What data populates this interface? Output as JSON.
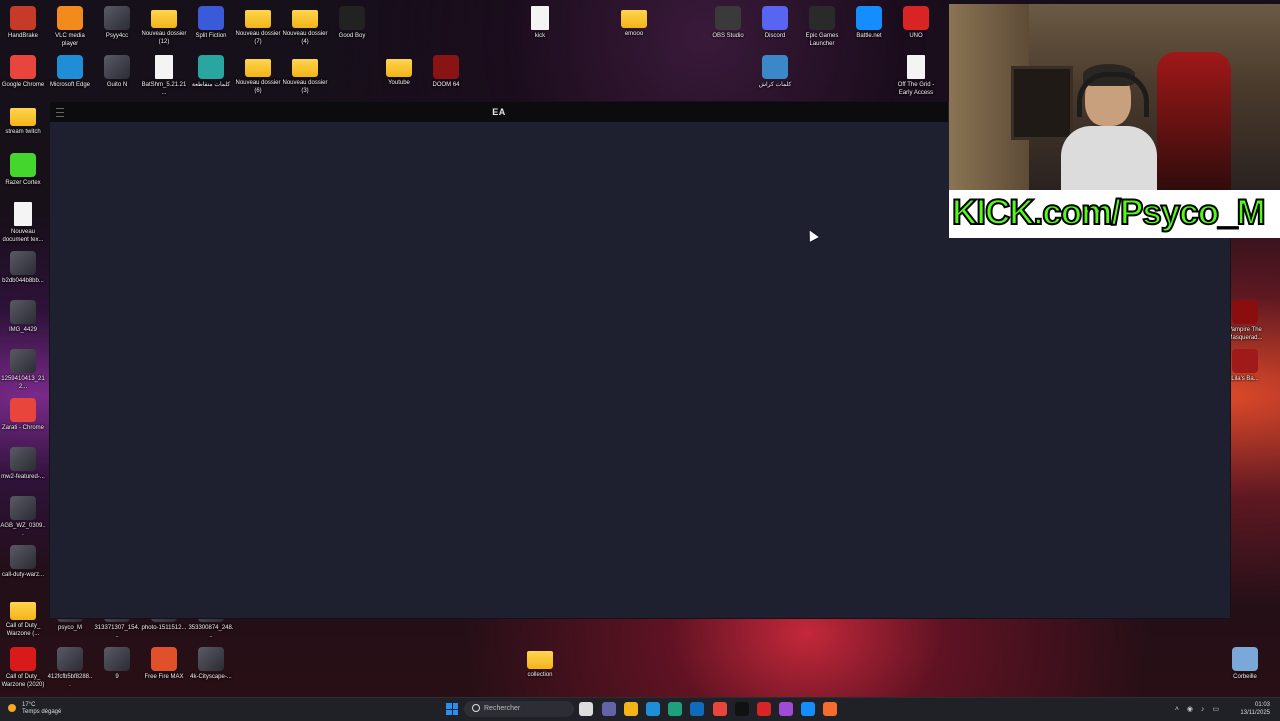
{
  "desktop": {
    "icons_top": [
      {
        "label": "HandBrake",
        "type": "app",
        "color": "#c63a2a"
      },
      {
        "label": "VLC media player",
        "type": "app",
        "color": "#f28a1c"
      },
      {
        "label": "Psyy4cc",
        "type": "photo",
        "color": ""
      },
      {
        "label": "Nouveau dossier (12)",
        "type": "folder",
        "color": ""
      },
      {
        "label": "Split Fiction",
        "type": "app",
        "color": "#3a5ad8"
      },
      {
        "label": "Nouveau dossier (7)",
        "type": "folder",
        "color": ""
      },
      {
        "label": "Nouveau dossier (4)",
        "type": "folder",
        "color": ""
      },
      {
        "label": "Good Boy",
        "type": "app",
        "color": "#222222"
      }
    ],
    "icons_top_row2": [
      {
        "label": "Google Chrome",
        "type": "app",
        "color": "#e8453c"
      },
      {
        "label": "Microsoft Edge",
        "type": "app",
        "color": "#1e8fd6"
      },
      {
        "label": "Guito N",
        "type": "photo",
        "color": ""
      },
      {
        "label": "BatShm_5.21.21...",
        "type": "doc",
        "color": ""
      },
      {
        "label": "كلمات متقاطعة",
        "type": "app",
        "color": "#2aa6a0"
      },
      {
        "label": "Nouveau dossier (6)",
        "type": "folder",
        "color": ""
      },
      {
        "label": "Nouveau dossier (3)",
        "type": "folder",
        "color": ""
      }
    ],
    "icons_mid": [
      {
        "label": "kick",
        "type": "doc",
        "color": ""
      },
      {
        "label": "emooo",
        "type": "folder",
        "color": ""
      },
      {
        "label": "Youtube",
        "type": "folder",
        "color": ""
      },
      {
        "label": "DOOM 64",
        "type": "app",
        "color": "#8a1414"
      },
      {
        "label": "OBS Studio",
        "type": "app",
        "color": "#3a3a3a"
      },
      {
        "label": "Discord",
        "type": "app",
        "color": "#5865f2"
      },
      {
        "label": "Epic Games Launcher",
        "type": "app",
        "color": "#2a2a2a"
      },
      {
        "label": "Battle.net",
        "type": "app",
        "color": "#148eff"
      },
      {
        "label": "UNO",
        "type": "app",
        "color": "#d82424"
      },
      {
        "label": "كلمات كراش",
        "type": "app",
        "color": "#3a88c8"
      },
      {
        "label": "Off The Grid - Early Access",
        "type": "doc",
        "color": ""
      }
    ],
    "icons_left": [
      {
        "label": "stream twitch",
        "type": "folder",
        "color": ""
      },
      {
        "label": "Razer Cortex",
        "type": "app",
        "color": "#44d62c"
      },
      {
        "label": "Nouveau document tex...",
        "type": "doc",
        "color": ""
      },
      {
        "label": "b2db044b8bb...",
        "type": "photo",
        "color": ""
      },
      {
        "label": "IMG_4429",
        "type": "photo",
        "color": ""
      },
      {
        "label": "1259410413_212...",
        "type": "photo",
        "color": ""
      },
      {
        "label": "Zarati - Chrome",
        "type": "app",
        "color": "#e8453c"
      },
      {
        "label": "mw2-featured-...",
        "type": "photo",
        "color": ""
      },
      {
        "label": "AGB_WZ_0309...",
        "type": "photo",
        "color": ""
      },
      {
        "label": "call-duty-warz...",
        "type": "photo",
        "color": ""
      },
      {
        "label": "Call of Duty_ Warzone (...",
        "type": "folder",
        "color": ""
      },
      {
        "label": "Call of Duty_ Warzone (2020)",
        "type": "app",
        "color": "#d81a1a"
      }
    ],
    "icons_bottom": [
      {
        "label": "psyco_M",
        "type": "photo",
        "color": ""
      },
      {
        "label": "313371307_154...",
        "type": "photo",
        "color": ""
      },
      {
        "label": "photo-1511512...",
        "type": "photo",
        "color": ""
      },
      {
        "label": "353300874_248...",
        "type": "photo",
        "color": ""
      },
      {
        "label": "412fcfb5bf8288...",
        "type": "photo",
        "color": ""
      },
      {
        "label": "9",
        "type": "photo",
        "color": ""
      },
      {
        "label": "Free Fire MAX",
        "type": "app",
        "color": "#e0502a"
      },
      {
        "label": "4k-Cityscape-...",
        "type": "photo",
        "color": ""
      },
      {
        "label": "collection",
        "type": "folder",
        "color": ""
      }
    ],
    "icons_right": [
      {
        "label": "Vampire The Masquerad...",
        "type": "app",
        "color": "#8a0e0e"
      },
      {
        "label": "Lila's Ba...",
        "type": "app",
        "color": "#a01a1a"
      },
      {
        "label": "Corbeille",
        "type": "app",
        "color": "#7aa8d8"
      }
    ]
  },
  "ea_window": {
    "title": "EA"
  },
  "stream_overlay": {
    "banner_text": "KICK.com/Psyco_M",
    "banner_color": "#53fc18"
  },
  "taskbar": {
    "weather_temp": "17°C",
    "weather_desc": "Temps dégagé",
    "search_placeholder": "Rechercher",
    "time": "01:03",
    "date": "13/11/2025",
    "apps": [
      {
        "name": "task-view-icon",
        "color": "#dddddd"
      },
      {
        "name": "teams-icon",
        "color": "#6264a7"
      },
      {
        "name": "file-explorer-icon",
        "color": "#f2b418"
      },
      {
        "name": "store-icon",
        "color": "#1e8fd6"
      },
      {
        "name": "edge-icon",
        "color": "#1ea07c"
      },
      {
        "name": "outlook-icon",
        "color": "#0f6cbd"
      },
      {
        "name": "chrome-icon",
        "color": "#e8453c"
      },
      {
        "name": "capcut-icon",
        "color": "#111111"
      },
      {
        "name": "redapp-icon",
        "color": "#d82424"
      },
      {
        "name": "messenger-icon",
        "color": "#a04ad8"
      },
      {
        "name": "battlenet-icon",
        "color": "#148eff"
      },
      {
        "name": "origin-icon",
        "color": "#f56c2d"
      }
    ]
  }
}
